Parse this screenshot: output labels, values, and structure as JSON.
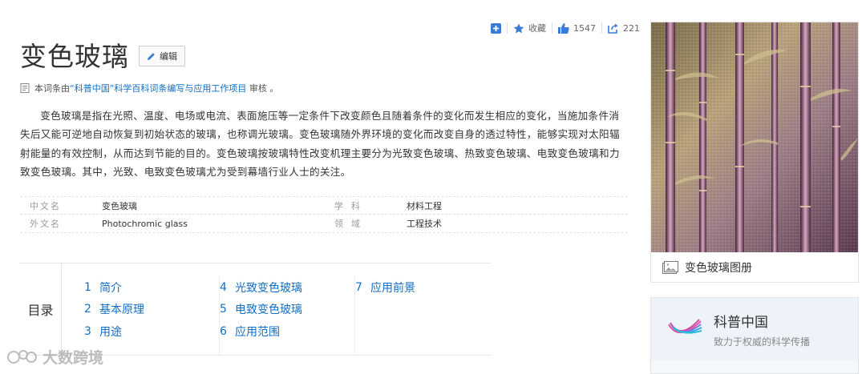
{
  "actions": {
    "collect": "收藏",
    "likes": "1547",
    "shares": "221"
  },
  "title": "变色玻璃",
  "edit_label": "编辑",
  "review": {
    "prefix": "本词条由",
    "link": "“科普中国”科学百科词条编写与应用工作项目",
    "suffix": " 审核 。"
  },
  "summary": "变色玻璃是指在光照、温度、电场或电流、表面施压等一定条件下改变颜色且随着条件的变化而发生相应的变化，当施加条件消失后又能可逆地自动恢复到初始状态的玻璃，也称调光玻璃。变色玻璃随外界环境的变化而改变自身的透过特性，能够实现对太阳辐射能量的有效控制，从而达到节能的目的。变色玻璃按玻璃特性改变机理主要分为光致变色玻璃、热致变色玻璃、电致变色玻璃和力致变色玻璃。其中，光致、电致变色玻璃尤为受到幕墙行业人士的关注。",
  "basic_info": [
    {
      "k1": "中文名",
      "v1": "变色玻璃",
      "k2": "学科",
      "v2": "材料工程"
    },
    {
      "k1": "外文名",
      "v1": "Photochromic glass",
      "k2": "领域",
      "v2": "工程技术"
    }
  ],
  "catalog": {
    "title": "目录",
    "columns": [
      [
        {
          "num": "1",
          "label": "简介"
        },
        {
          "num": "2",
          "label": "基本原理"
        },
        {
          "num": "3",
          "label": "用途"
        }
      ],
      [
        {
          "num": "4",
          "label": "光致变色玻璃"
        },
        {
          "num": "5",
          "label": "电致变色玻璃"
        },
        {
          "num": "6",
          "label": "应用范围"
        }
      ],
      [
        {
          "num": "7",
          "label": "应用前景"
        }
      ]
    ]
  },
  "album_label": "变色玻璃图册",
  "kepu": {
    "name": "科普中国",
    "slogan": "致力于权威的科学传播"
  },
  "watermark": "大数跨境",
  "colors": {
    "link": "#136ec2",
    "icon_blue": "#3a7bd5"
  }
}
